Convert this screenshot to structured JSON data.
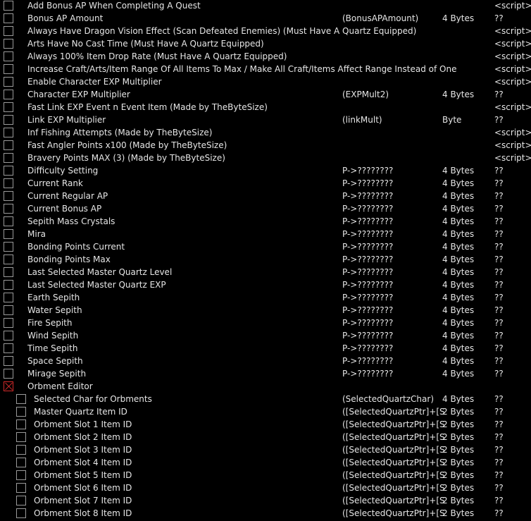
{
  "rows": [
    {
      "description": "Add Bonus AP When Completing A Quest",
      "address": "",
      "type": "",
      "value": "<script>",
      "checked": false,
      "level": 0
    },
    {
      "description": "Bonus AP Amount",
      "address": "(BonusAPAmount)",
      "type": "4 Bytes",
      "value": "??",
      "checked": false,
      "level": 0
    },
    {
      "description": "Always Have Dragon Vision Effect (Scan Defeated Enemies) (Must Have A Quartz Equipped)",
      "address": "",
      "type": "",
      "value": "<script>",
      "checked": false,
      "level": 0
    },
    {
      "description": "Arts Have No Cast Time (Must Have A Quartz Equipped)",
      "address": "",
      "type": "",
      "value": "<script>",
      "checked": false,
      "level": 0
    },
    {
      "description": "Always 100% Item Drop Rate (Must Have A Quartz Equipped)",
      "address": "",
      "type": "",
      "value": "<script>",
      "checked": false,
      "level": 0
    },
    {
      "description": "Increase Craft/Arts/Item Range Of All Items To Max / Make All Craft/Items Affect Range Instead of One",
      "address": "",
      "type": "",
      "value": "<script>",
      "checked": false,
      "level": 0
    },
    {
      "description": "Enable Character EXP Multiplier",
      "address": "",
      "type": "",
      "value": "<script>",
      "checked": false,
      "level": 0
    },
    {
      "description": "Character EXP Multiplier",
      "address": "(EXPMult2)",
      "type": "4 Bytes",
      "value": "??",
      "checked": false,
      "level": 0
    },
    {
      "description": "Fast Link EXP Event n Event Item (Made by TheByteSize)",
      "address": "",
      "type": "",
      "value": "<script>",
      "checked": false,
      "level": 0
    },
    {
      "description": "Link EXP Multiplier",
      "address": "(linkMult)",
      "type": "Byte",
      "value": "??",
      "checked": false,
      "level": 0
    },
    {
      "description": "Inf Fishing Attempts (Made by TheByteSize)",
      "address": "",
      "type": "",
      "value": "<script>",
      "checked": false,
      "level": 0
    },
    {
      "description": "Fast Angler Points x100 (Made by TheByteSize)",
      "address": "",
      "type": "",
      "value": "<script>",
      "checked": false,
      "level": 0
    },
    {
      "description": "Bravery Points MAX (3) (Made by TheByteSize)",
      "address": "",
      "type": "",
      "value": "<script>",
      "checked": false,
      "level": 0
    },
    {
      "description": "Difficulty Setting",
      "address": "P->????????",
      "type": "4 Bytes",
      "value": "??",
      "checked": false,
      "level": 0
    },
    {
      "description": "Current Rank",
      "address": "P->????????",
      "type": "4 Bytes",
      "value": "??",
      "checked": false,
      "level": 0
    },
    {
      "description": "Current Regular AP",
      "address": "P->????????",
      "type": "4 Bytes",
      "value": "??",
      "checked": false,
      "level": 0
    },
    {
      "description": "Current Bonus AP",
      "address": "P->????????",
      "type": "4 Bytes",
      "value": "??",
      "checked": false,
      "level": 0
    },
    {
      "description": "Sepith Mass Crystals",
      "address": "P->????????",
      "type": "4 Bytes",
      "value": "??",
      "checked": false,
      "level": 0
    },
    {
      "description": "Mira",
      "address": "P->????????",
      "type": "4 Bytes",
      "value": "??",
      "checked": false,
      "level": 0
    },
    {
      "description": "Bonding Points Current",
      "address": "P->????????",
      "type": "4 Bytes",
      "value": "??",
      "checked": false,
      "level": 0
    },
    {
      "description": "Bonding Points Max",
      "address": "P->????????",
      "type": "4 Bytes",
      "value": "??",
      "checked": false,
      "level": 0
    },
    {
      "description": "Last Selected Master Quartz Level",
      "address": "P->????????",
      "type": "4 Bytes",
      "value": "??",
      "checked": false,
      "level": 0
    },
    {
      "description": "Last Selected Master Quartz EXP",
      "address": "P->????????",
      "type": "4 Bytes",
      "value": "??",
      "checked": false,
      "level": 0
    },
    {
      "description": "Earth Sepith",
      "address": "P->????????",
      "type": "4 Bytes",
      "value": "??",
      "checked": false,
      "level": 0
    },
    {
      "description": "Water Sepith",
      "address": "P->????????",
      "type": "4 Bytes",
      "value": "??",
      "checked": false,
      "level": 0
    },
    {
      "description": "Fire Sepith",
      "address": "P->????????",
      "type": "4 Bytes",
      "value": "??",
      "checked": false,
      "level": 0
    },
    {
      "description": "Wind Sepith",
      "address": "P->????????",
      "type": "4 Bytes",
      "value": "??",
      "checked": false,
      "level": 0
    },
    {
      "description": "Time Sepith",
      "address": "P->????????",
      "type": "4 Bytes",
      "value": "??",
      "checked": false,
      "level": 0
    },
    {
      "description": "Space Sepith",
      "address": "P->????????",
      "type": "4 Bytes",
      "value": "??",
      "checked": false,
      "level": 0
    },
    {
      "description": "Mirage Sepith",
      "address": "P->????????",
      "type": "4 Bytes",
      "value": "??",
      "checked": false,
      "level": 0
    },
    {
      "description": "Orbment Editor",
      "address": "",
      "type": "",
      "value": "",
      "checked": true,
      "level": 0
    },
    {
      "description": "Selected Char for Orbments",
      "address": "(SelectedQuartzChar)",
      "type": "4 Bytes",
      "value": "??",
      "checked": false,
      "level": 1
    },
    {
      "description": "Master Quartz Item ID",
      "address": "([SelectedQuartzPtr]+[Sele",
      "type": "2 Bytes",
      "value": "??",
      "checked": false,
      "level": 1
    },
    {
      "description": "Orbment Slot 1 Item ID",
      "address": "([SelectedQuartzPtr]+[Sele",
      "type": "2 Bytes",
      "value": "??",
      "checked": false,
      "level": 1
    },
    {
      "description": "Orbment Slot 2 Item ID",
      "address": "([SelectedQuartzPtr]+[Sele",
      "type": "2 Bytes",
      "value": "??",
      "checked": false,
      "level": 1
    },
    {
      "description": "Orbment Slot 3 Item ID",
      "address": "([SelectedQuartzPtr]+[Sele",
      "type": "2 Bytes",
      "value": "??",
      "checked": false,
      "level": 1
    },
    {
      "description": "Orbment Slot 4 Item ID",
      "address": "([SelectedQuartzPtr]+[Sele",
      "type": "2 Bytes",
      "value": "??",
      "checked": false,
      "level": 1
    },
    {
      "description": "Orbment Slot 5 Item ID",
      "address": "([SelectedQuartzPtr]+[Sele",
      "type": "2 Bytes",
      "value": "??",
      "checked": false,
      "level": 1
    },
    {
      "description": "Orbment Slot 6 Item ID",
      "address": "([SelectedQuartzPtr]+[Sele",
      "type": "2 Bytes",
      "value": "??",
      "checked": false,
      "level": 1
    },
    {
      "description": "Orbment Slot 7 Item ID",
      "address": "([SelectedQuartzPtr]+[Sele",
      "type": "2 Bytes",
      "value": "??",
      "checked": false,
      "level": 1
    },
    {
      "description": "Orbment Slot 8 Item ID",
      "address": "([SelectedQuartzPtr]+[Sele",
      "type": "2 Bytes",
      "value": "??",
      "checked": false,
      "level": 1
    }
  ],
  "colors": {
    "background": "#000000",
    "text": "#e6e6e6",
    "checkbox_border": "#9a9a9a",
    "checked_mark": "#d42a2a"
  }
}
